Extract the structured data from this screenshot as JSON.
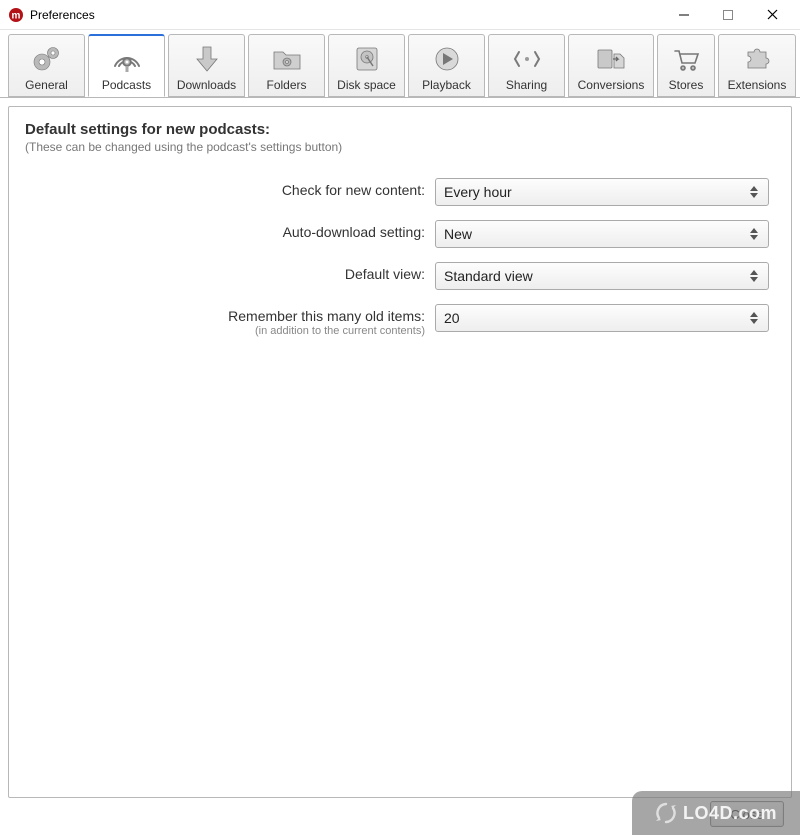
{
  "window": {
    "title": "Preferences"
  },
  "tabs": [
    {
      "id": "general",
      "label": "General"
    },
    {
      "id": "podcasts",
      "label": "Podcasts"
    },
    {
      "id": "downloads",
      "label": "Downloads"
    },
    {
      "id": "folders",
      "label": "Folders"
    },
    {
      "id": "diskspace",
      "label": "Disk space"
    },
    {
      "id": "playback",
      "label": "Playback"
    },
    {
      "id": "sharing",
      "label": "Sharing"
    },
    {
      "id": "conversions",
      "label": "Conversions"
    },
    {
      "id": "stores",
      "label": "Stores"
    },
    {
      "id": "extensions",
      "label": "Extensions"
    }
  ],
  "selected_tab": "podcasts",
  "podcasts": {
    "heading": "Default settings for new podcasts:",
    "subheading": "(These can be changed using the podcast's settings button)",
    "fields": {
      "check_label": "Check for new content:",
      "check_value": "Every hour",
      "autodl_label": "Auto-download setting:",
      "autodl_value": "New",
      "view_label": "Default view:",
      "view_value": "Standard view",
      "remember_label": "Remember this many old items:",
      "remember_hint": "(in addition to the current contents)",
      "remember_value": "20"
    }
  },
  "buttons": {
    "close": "Close"
  },
  "watermark": "LO4D.com"
}
